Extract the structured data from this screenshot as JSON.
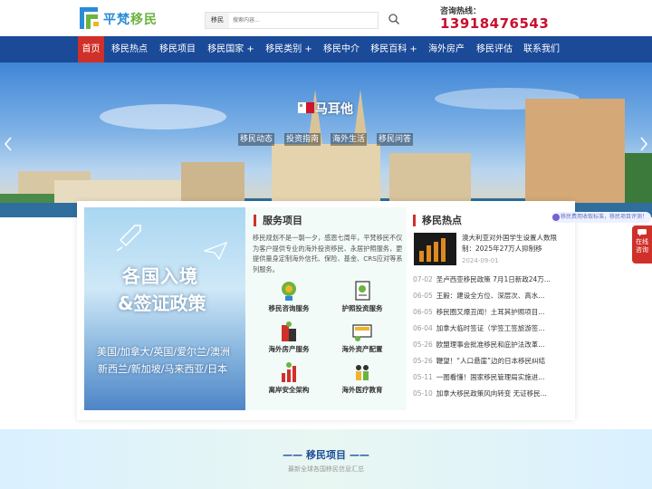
{
  "header": {
    "logo_text_1": "平梵",
    "logo_text_2": "移民",
    "search_category": "移民",
    "search_placeholder": "搜索内容...",
    "hotline_label": "咨询热线：",
    "hotline_number": "13918476543"
  },
  "nav": {
    "items": [
      {
        "label": "首页"
      },
      {
        "label": "移民热点"
      },
      {
        "label": "移民项目"
      },
      {
        "label": "移民国家 +"
      },
      {
        "label": "移民类别 +"
      },
      {
        "label": "移民中介"
      },
      {
        "label": "移民百科 +"
      },
      {
        "label": "海外房产"
      },
      {
        "label": "移民评估"
      },
      {
        "label": "联系我们"
      }
    ]
  },
  "hero": {
    "country": "马耳他",
    "tags": [
      "移民动态",
      "投资指南",
      "海外生活",
      "移民问答"
    ]
  },
  "promo": {
    "line1": "各国入境",
    "line2": "&签证政策",
    "line3": "美国/加拿大/英国/爱尔兰/澳洲",
    "line4": "新西兰/新加坡/马来西亚/日本"
  },
  "services": {
    "title": "服务项目",
    "description": "移民规划不是一朝一夕，感恩七周年，平梵移民不仅为客户提供专业的海外投资移民、永居护照服务，更提供量身定制海外信托、保险、基金、CRS应对等系列服务。",
    "items": [
      {
        "label": "移民咨询服务",
        "icon": "globe-consult-icon"
      },
      {
        "label": "护照投资服务",
        "icon": "passport-icon"
      },
      {
        "label": "海外房产服务",
        "icon": "building-icon"
      },
      {
        "label": "海外资产配置",
        "icon": "visa-icon"
      },
      {
        "label": "离岸安全架构",
        "icon": "chart-icon"
      },
      {
        "label": "海外医疗教育",
        "icon": "people-icon"
      }
    ]
  },
  "news": {
    "title": "移民热点",
    "featured": {
      "title": "澳大利亚对外国学生设置人数限制：2025年27万人抑制移",
      "date": "2024-09-01"
    },
    "items": [
      {
        "date": "07-02",
        "title": "圣卢西亚移民政策 7月1日新政24万..."
      },
      {
        "date": "06-05",
        "title": "王毅：建设全方位、深层次、高水..."
      },
      {
        "date": "06-05",
        "title": "移民圈又爆丑闻！土耳其护照项目..."
      },
      {
        "date": "06-04",
        "title": "加拿大临时签证（学签工签旅游签..."
      },
      {
        "date": "05-26",
        "title": "欧盟理事会批准移民和庇护法改革..."
      },
      {
        "date": "05-26",
        "title": "鞭望！“人口悬崖”边的日本移民纠结"
      },
      {
        "date": "05-11",
        "title": "一图看懂！国家移民管理局实施进..."
      },
      {
        "date": "05-10",
        "title": "加拿大移民政策风向转变 无证移民..."
      }
    ]
  },
  "float_ticker": "移民费用收取标准，移民项目评测！",
  "online": "在线咨询",
  "projects": {
    "title": "—— 移民项目 ——",
    "subtitle": "最新全球各国移民信息汇总"
  }
}
